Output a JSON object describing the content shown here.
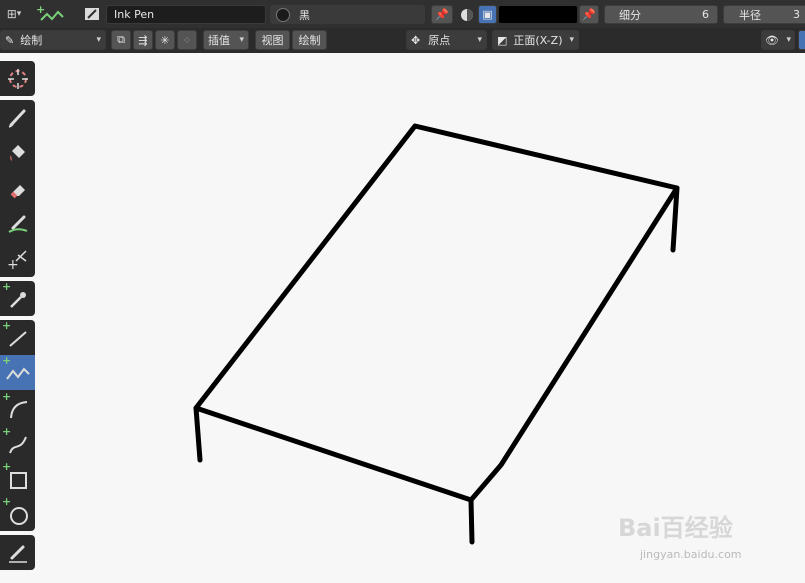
{
  "header": {
    "brush_name": "Ink Pen",
    "material_name": "黑",
    "subdivision_label": "细分",
    "subdivision_value": "6",
    "radius_label": "半径",
    "radius_value_partial": "3",
    "color_swatch": "#000000"
  },
  "tool_settings": {
    "mode_label": "绘制",
    "interpolate_label": "插值",
    "view_label": "视图",
    "draw_label": "绘制",
    "origin_label": "原点",
    "orientation_label": "正面(X-Z)"
  },
  "toolbar": {
    "tools": [
      "cursor",
      "draw",
      "fill",
      "erase",
      "tint",
      "cutter",
      "eyedropper",
      "line",
      "polyline",
      "arc",
      "curve",
      "box",
      "circle",
      "annotate"
    ],
    "active_tool": "polyline"
  },
  "watermark": {
    "logo_text": "Bai百经验",
    "url_text": "jingyan.baidu.com"
  },
  "colors": {
    "accent": "#4772b3",
    "header_bg": "#303030",
    "viewport_bg": "#f7f7f7",
    "stroke": "#000000",
    "plus": "#7ad17a"
  }
}
